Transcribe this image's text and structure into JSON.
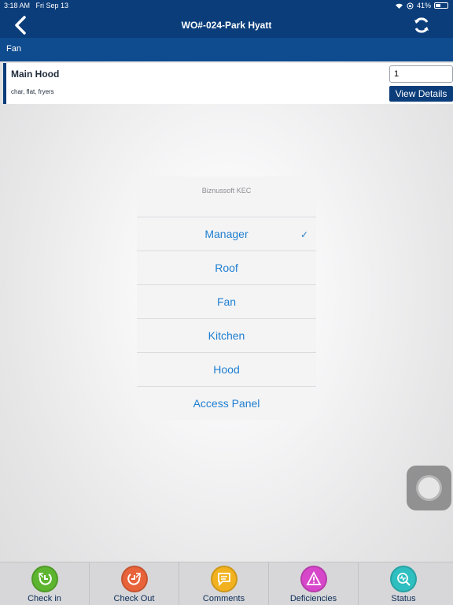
{
  "status_bar": {
    "time": "3:18 AM",
    "date": "Fri Sep 13",
    "battery": "41%"
  },
  "nav": {
    "title": "WO#-024-Park Hyatt",
    "back_icon": "chevron-left-icon",
    "sync_icon": "sync-icon"
  },
  "section": {
    "title": "Fan"
  },
  "item": {
    "name": "Main Hood",
    "subtitle": "char, flat, fryers",
    "quantity": "1",
    "details_label": "View Details"
  },
  "sheet": {
    "title": "Biznussoft KEC",
    "options": [
      {
        "label": "Manager",
        "selected": true
      },
      {
        "label": "Roof",
        "selected": false
      },
      {
        "label": "Fan",
        "selected": false
      },
      {
        "label": "Kitchen",
        "selected": false
      },
      {
        "label": "Hood",
        "selected": false
      },
      {
        "label": "Access Panel",
        "selected": false
      }
    ],
    "check_glyph": "✓"
  },
  "tabs": [
    {
      "label": "Check in",
      "icon": "check-in-icon",
      "color": "#5db52f"
    },
    {
      "label": "Check Out",
      "icon": "check-out-icon",
      "color": "#e8633a"
    },
    {
      "label": "Comments",
      "icon": "comments-icon",
      "color": "#f2b21f"
    },
    {
      "label": "Deficiencies",
      "icon": "deficiencies-icon",
      "color": "#d647c9"
    },
    {
      "label": "Status",
      "icon": "status-icon",
      "color": "#2fbfc0"
    }
  ],
  "colors": {
    "brand": "#0a3d7a",
    "section": "#0f4b8f",
    "link": "#1f7fd0"
  }
}
